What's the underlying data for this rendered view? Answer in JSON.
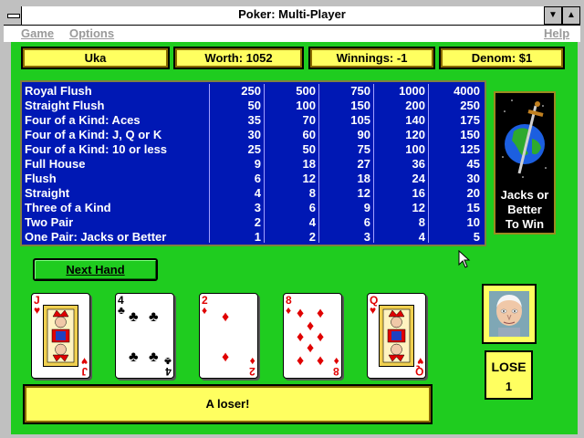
{
  "window": {
    "title": "Poker: Multi-Player"
  },
  "menu": {
    "game": "Game",
    "options": "Options",
    "help": "Help"
  },
  "info": {
    "player": "Uka",
    "worth": "Worth: 1052",
    "winnings": "Winnings: -1",
    "denom": "Denom: $1"
  },
  "paytable": [
    {
      "hand": "Royal Flush",
      "pays": [
        "250",
        "500",
        "750",
        "1000",
        "4000"
      ]
    },
    {
      "hand": "Straight Flush",
      "pays": [
        "50",
        "100",
        "150",
        "200",
        "250"
      ]
    },
    {
      "hand": "Four of a Kind: Aces",
      "pays": [
        "35",
        "70",
        "105",
        "140",
        "175"
      ]
    },
    {
      "hand": "Four of a Kind: J, Q or K",
      "pays": [
        "30",
        "60",
        "90",
        "120",
        "150"
      ]
    },
    {
      "hand": "Four of a Kind: 10 or less",
      "pays": [
        "25",
        "50",
        "75",
        "100",
        "125"
      ]
    },
    {
      "hand": "Full House",
      "pays": [
        "9",
        "18",
        "27",
        "36",
        "45"
      ]
    },
    {
      "hand": "Flush",
      "pays": [
        "6",
        "12",
        "18",
        "24",
        "30"
      ]
    },
    {
      "hand": "Straight",
      "pays": [
        "4",
        "8",
        "12",
        "16",
        "20"
      ]
    },
    {
      "hand": "Three of a Kind",
      "pays": [
        "3",
        "6",
        "9",
        "12",
        "15"
      ]
    },
    {
      "hand": "Two Pair",
      "pays": [
        "2",
        "4",
        "6",
        "8",
        "10"
      ]
    },
    {
      "hand": "One Pair: Jacks or Better",
      "pays": [
        "1",
        "2",
        "3",
        "4",
        "5"
      ]
    }
  ],
  "game_banner": {
    "line1": "Jacks or",
    "line2": "Better",
    "line3": "To Win",
    "icon": "globe-with-sword-icon"
  },
  "next_hand_label": "Next Hand",
  "cards": [
    {
      "rank": "J",
      "suit": "hearts",
      "symbol": "♥",
      "color": "#e00000"
    },
    {
      "rank": "4",
      "suit": "clubs",
      "symbol": "♣",
      "color": "#000000"
    },
    {
      "rank": "2",
      "suit": "diamonds",
      "symbol": "♦",
      "color": "#e00000"
    },
    {
      "rank": "8",
      "suit": "diamonds",
      "symbol": "♦",
      "color": "#e00000"
    },
    {
      "rank": "Q",
      "suit": "hearts",
      "symbol": "♥",
      "color": "#e00000"
    }
  ],
  "message": "A loser!",
  "opponent": {
    "icon": "old-man-avatar-icon",
    "status": "LOSE",
    "count": "1"
  },
  "colors": {
    "table_green": "#1fcc1f",
    "paytable_blue": "#0018b4",
    "info_yellow": "#ffff60"
  }
}
